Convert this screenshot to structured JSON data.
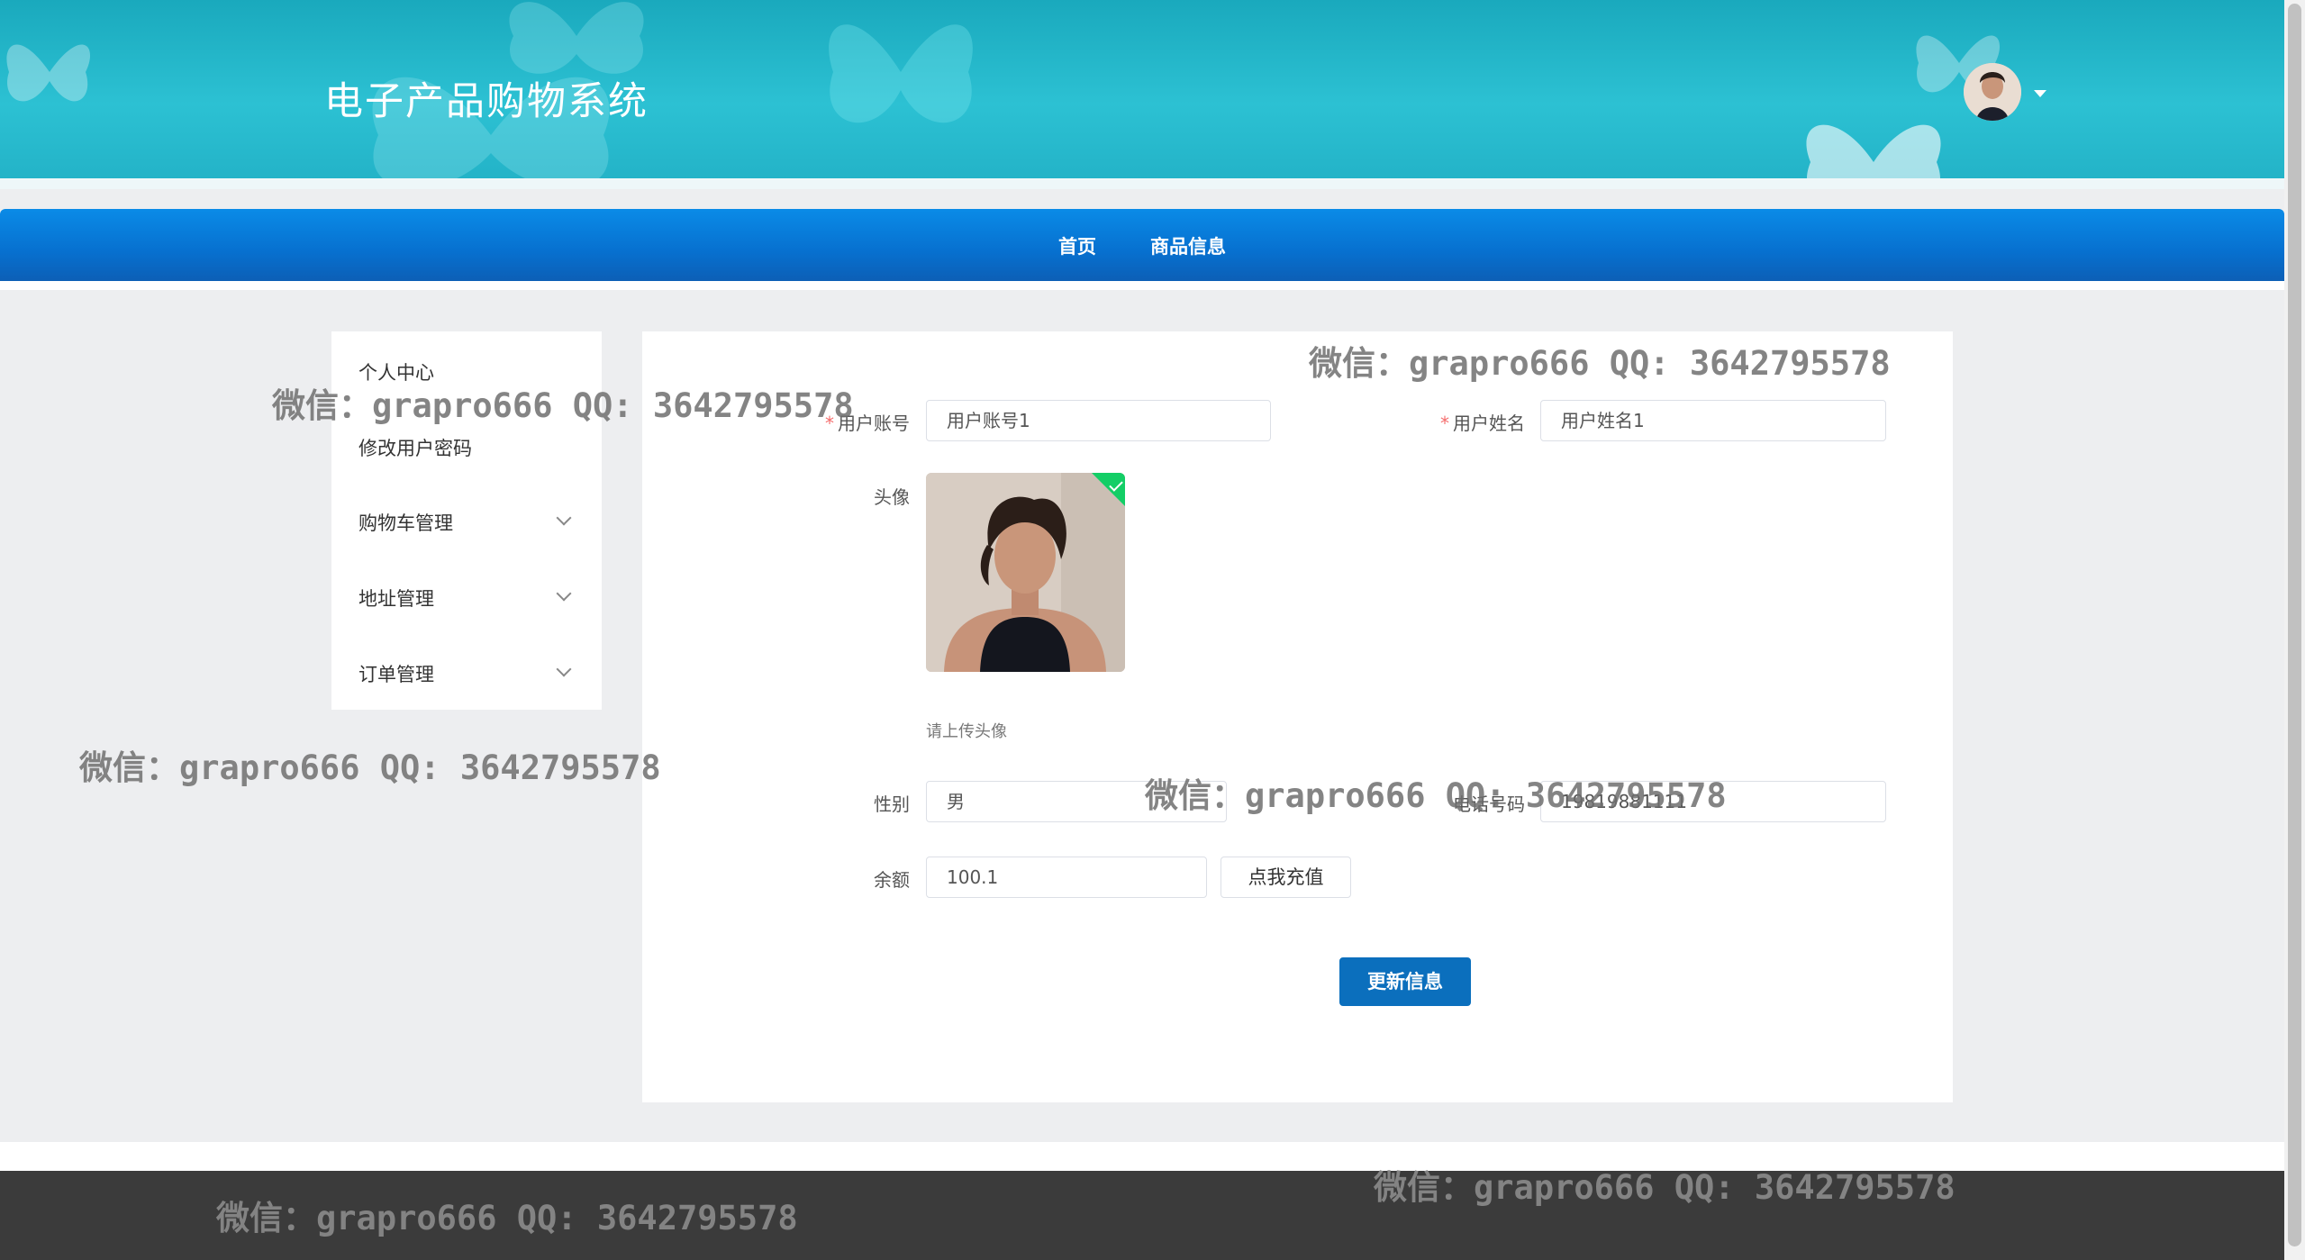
{
  "header": {
    "site_title": "电子产品购物系统",
    "user_avatar_icon": "user-avatar",
    "dropdown_icon": "caret-down-icon"
  },
  "nav": {
    "items": [
      {
        "label": "首页"
      },
      {
        "label": "商品信息"
      }
    ]
  },
  "sidebar": {
    "items": [
      {
        "label": "个人中心",
        "expandable": false
      },
      {
        "label": "修改用户密码",
        "expandable": false
      },
      {
        "label": "购物车管理",
        "expandable": true
      },
      {
        "label": "地址管理",
        "expandable": true
      },
      {
        "label": "订单管理",
        "expandable": true
      }
    ]
  },
  "form": {
    "account": {
      "label": "用户账号",
      "required_mark": "*",
      "value": "用户账号1"
    },
    "name": {
      "label": "用户姓名",
      "required_mark": "*",
      "value": "用户姓名1"
    },
    "avatar": {
      "label": "头像",
      "hint": "请上传头像",
      "status_icon": "check-icon"
    },
    "gender": {
      "label": "性别",
      "value": "男"
    },
    "phone": {
      "label": "电话号码",
      "value": "19819881111"
    },
    "balance": {
      "label": "余额",
      "value": "100.1",
      "recharge_button": "点我充值"
    },
    "submit_button": "更新信息"
  },
  "watermarks": [
    "微信：grapro666 QQ: 3642795578",
    "微信：grapro666 QQ: 3642795578",
    "微信：grapro666 QQ: 3642795578",
    "微信：grapro666 QQ: 3642795578",
    "微信：grapro666 QQ: 3642795578",
    "微信：grapro666 QQ: 3642795578"
  ],
  "colors": {
    "header": "#22b4c8",
    "nav": "#0770cf",
    "primary_button": "#0b6fbd",
    "required": "#f56c6c",
    "upload_success": "#13ce66",
    "footer": "#3b3b3b"
  }
}
